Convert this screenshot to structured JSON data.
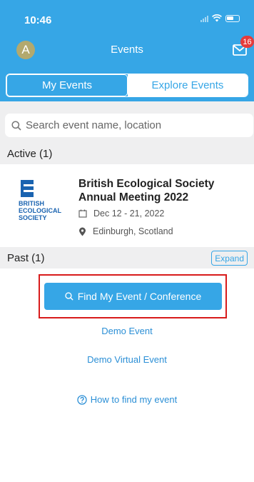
{
  "status": {
    "time": "10:46"
  },
  "header": {
    "avatar_letter": "A",
    "title": "Events",
    "mail_badge": "16"
  },
  "tabs": [
    {
      "label": "My Events",
      "active": true
    },
    {
      "label": "Explore Events",
      "active": false
    }
  ],
  "search": {
    "placeholder": "Search event name, location"
  },
  "sections": {
    "active_label": "Active (1)",
    "past_label": "Past (1)",
    "expand_label": "Expand"
  },
  "event": {
    "logo_text": [
      "BRITISH",
      "ECOLOGICAL",
      "SOCIETY"
    ],
    "title": "British Ecological Society Annual Meeting 2022",
    "dates": "Dec 12 - 21, 2022",
    "location": "Edinburgh, Scotland"
  },
  "actions": {
    "find_label": "Find My Event / Conference",
    "demo_event": "Demo Event",
    "demo_virtual_event": "Demo Virtual Event",
    "help_label": "How to find my event"
  },
  "colors": {
    "primary": "#36a6e6",
    "link": "#2b8fd6",
    "highlight": "#d81b1b",
    "badge": "#e63b3b",
    "logo": "#1a63b0"
  }
}
